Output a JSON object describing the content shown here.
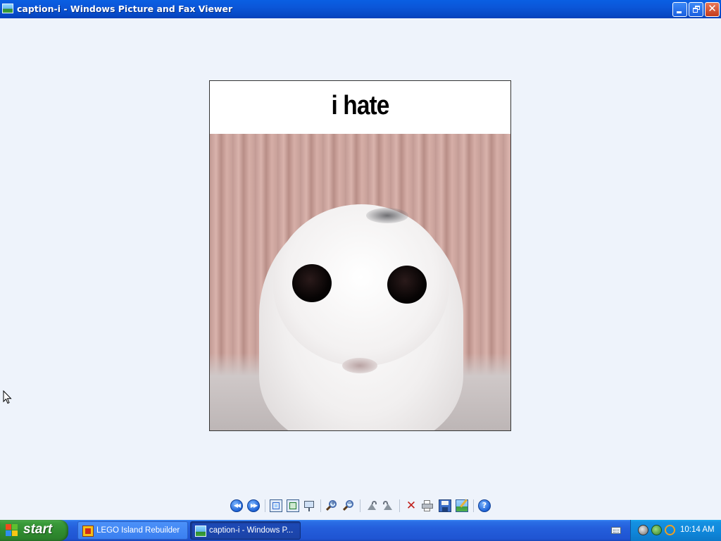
{
  "window": {
    "title": "caption-i - Windows Picture and Fax Viewer",
    "icon": "picture-viewer-icon",
    "controls": [
      "minimize",
      "restore",
      "close"
    ]
  },
  "picture": {
    "caption": "i hate",
    "subject": "white seal photo"
  },
  "toolbar": {
    "buttons": [
      {
        "name": "previous-image",
        "icon": "previous-icon"
      },
      {
        "name": "next-image",
        "icon": "next-icon"
      },
      {
        "name": "best-fit",
        "icon": "best-fit-icon"
      },
      {
        "name": "actual-size",
        "icon": "actual-size-icon"
      },
      {
        "name": "slide-show",
        "icon": "slideshow-icon"
      },
      {
        "name": "zoom-in",
        "icon": "zoom-in-icon"
      },
      {
        "name": "zoom-out",
        "icon": "zoom-out-icon"
      },
      {
        "name": "rotate-clockwise",
        "icon": "rotate-cw-icon"
      },
      {
        "name": "rotate-counterclockwise",
        "icon": "rotate-ccw-icon"
      },
      {
        "name": "delete",
        "icon": "delete-icon"
      },
      {
        "name": "print",
        "icon": "print-icon"
      },
      {
        "name": "copy-to",
        "icon": "save-icon"
      },
      {
        "name": "edit",
        "icon": "edit-icon"
      },
      {
        "name": "help",
        "icon": "help-icon"
      }
    ],
    "help_glyph": "?",
    "delete_glyph": "✕"
  },
  "taskbar": {
    "start_label": "start",
    "tasks": [
      {
        "label": "LEGO Island Rebuilder",
        "active": false
      },
      {
        "label": "caption-i - Windows P...",
        "active": true
      }
    ],
    "clock": "10:14 AM"
  }
}
